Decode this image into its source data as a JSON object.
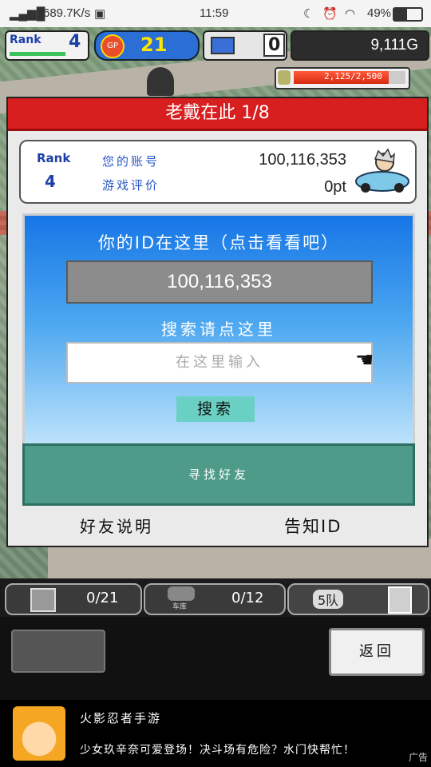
{
  "status_bar": {
    "net_speed": "689.7K/s",
    "time": "11:59",
    "battery": "49%"
  },
  "hud": {
    "rank_label": "Rank",
    "rank_value": "4",
    "gp_label": "GP",
    "gp_value": "21",
    "pc_value": "0",
    "gold": "9,111G",
    "stamina": "2,125/2,500",
    "stamina_fraction": 0.85
  },
  "dialog": {
    "title": "老戴在此 1/8",
    "profile": {
      "rank_label": "Rank",
      "rank_value": "4",
      "account_label": "您的账号",
      "rating_label": "游戏评价",
      "account_value": "100,116,353",
      "rating_value": "0pt"
    },
    "id_heading": "你的ID在这里（点击看看吧）",
    "id_value": "100,116,353",
    "search_heading": "搜索请点这里",
    "search_placeholder": "在这里输入",
    "search_button": "搜索",
    "find_friends": "寻找好友",
    "friend_help": "好友说明",
    "tell_id": "告知ID"
  },
  "bottom": {
    "slot1_count": "0/21",
    "slot2_label": "车库",
    "slot2_count": "0/12",
    "slot3_label": "5队",
    "back_button": "返回"
  },
  "ad": {
    "title": "火影忍者手游",
    "text": "少女玖辛奈可爱登场！决斗场有危险？水门快帮忙！",
    "tag": "广告"
  },
  "colors": {
    "title_red": "#d81f1f",
    "panel_blue": "#1776e6",
    "teal": "#4f9b8a",
    "button_teal": "#6ad0c4"
  }
}
